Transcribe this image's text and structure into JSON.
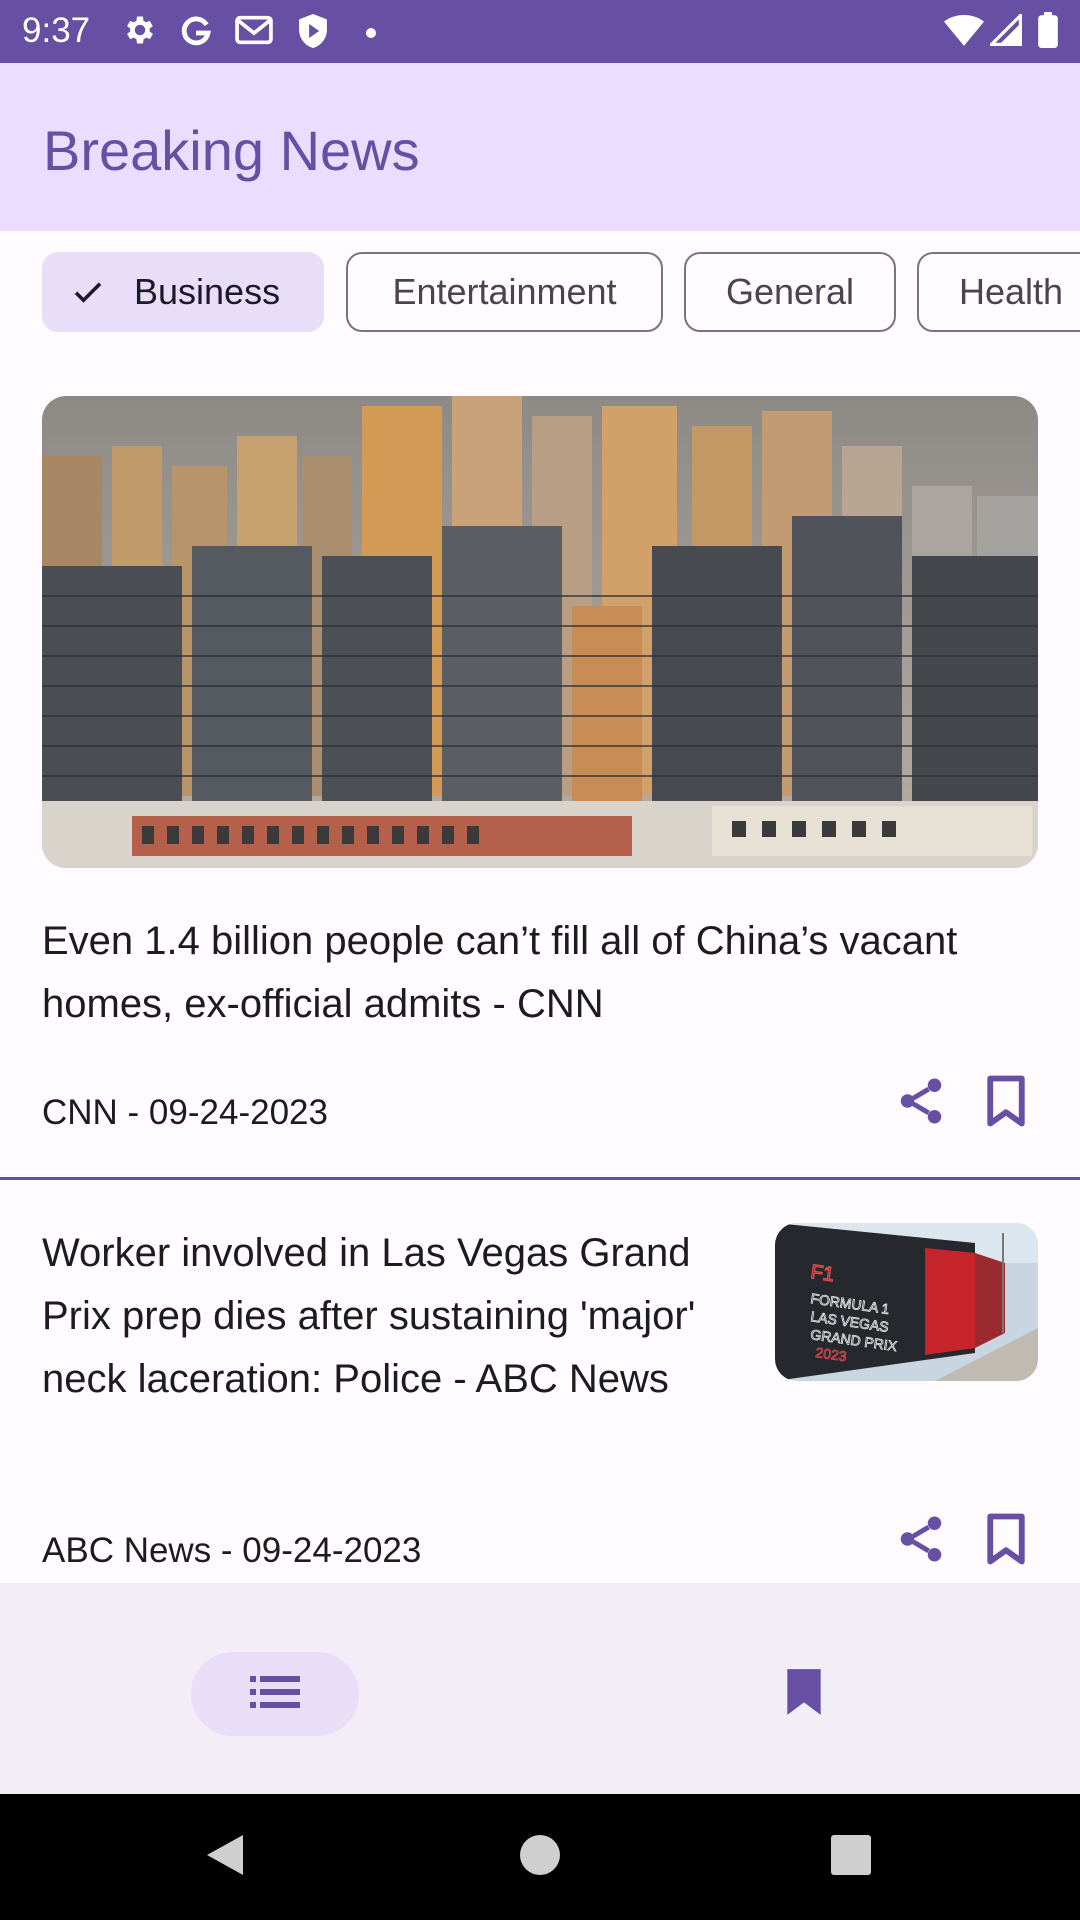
{
  "status_bar": {
    "time": "9:37",
    "left_icons": [
      "gear-icon",
      "google-icon",
      "gmail-icon",
      "play-protect-icon",
      "dot-icon"
    ],
    "right_icons": [
      "wifi-icon",
      "signal-icon",
      "battery-icon"
    ]
  },
  "app_bar": {
    "title": "Breaking News"
  },
  "categories": {
    "items": [
      {
        "label": "Business",
        "selected": true
      },
      {
        "label": "Entertainment",
        "selected": false
      },
      {
        "label": "General",
        "selected": false
      },
      {
        "label": "Health",
        "selected": false
      }
    ]
  },
  "articles": [
    {
      "headline": "Even 1.4 billion people can’t fill all of China’s vacant homes, ex-official admits - CNN",
      "meta": "CNN - 09-24-2023",
      "image": "apartment-towers-photo"
    },
    {
      "headline": "Worker involved in Las Vegas Grand Prix prep dies after sustaining 'major' neck laceration: Police - ABC News",
      "meta": "ABC News - 09-24-2023",
      "image": "formula-1-las-vegas-grand-prix-banner-photo"
    }
  ],
  "actions": {
    "share_icon": "share-icon",
    "bookmark_icon": "bookmark-outline-icon"
  },
  "bottom_nav": {
    "items": [
      {
        "icon": "list-icon",
        "selected": true
      },
      {
        "icon": "bookmark-filled-icon",
        "selected": false
      }
    ]
  },
  "system_nav": {
    "icons": [
      "back-icon",
      "home-icon",
      "recents-icon"
    ]
  },
  "colors": {
    "primary": "#6750a4",
    "primary_container": "#eaddff",
    "secondary_container": "#e8def8",
    "surface": "#fffbfe",
    "nav_surface": "#f3edf7"
  }
}
